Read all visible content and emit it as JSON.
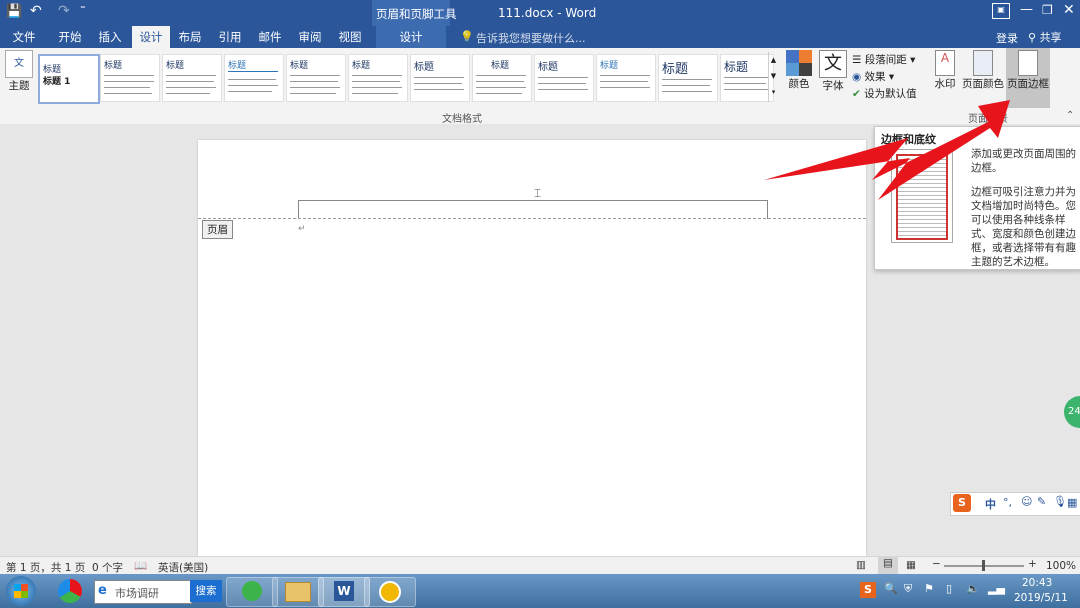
{
  "titlebar": {
    "context_group": "页眉和页脚工具",
    "document_title": "111.docx - Word",
    "quick_access": {
      "save": "💾",
      "undo": "↶",
      "redo": "↷"
    }
  },
  "tabs": [
    "文件",
    "开始",
    "插入",
    "设计",
    "布局",
    "引用",
    "邮件",
    "审阅",
    "视图"
  ],
  "context_tab": "设计",
  "tellme": "告诉我您想要做什么...",
  "signin": "登录",
  "share": "共享",
  "ribbon": {
    "theme_label": "主题",
    "style_titles": [
      "标题",
      "标题",
      "标题",
      "标题",
      "标题",
      "标题",
      "标题",
      "标题",
      "标题",
      "标题",
      "标题",
      "标题"
    ],
    "first_thumb_title": "标题 1",
    "gallery_group_label": "文档格式",
    "colors_label": "颜色",
    "fonts_label": "字体",
    "para_spacing_label": "段落间距",
    "effects_label": "效果",
    "set_default_label": "设为默认值",
    "watermark_label": "水印",
    "page_color_label": "页面颜色",
    "page_border_label": "页面边框",
    "page_bg_group_label": "页面背景"
  },
  "document": {
    "header_tag": "页眉"
  },
  "tooltip": {
    "title": "边框和底纹",
    "line1": "添加或更改页面周围的边框。",
    "line2": "边框可吸引注意力并为文档增加时尚特色。您可以使用各种线条样式、宽度和颜色创建边框，或者选择带有有趣主题的艺术边框。"
  },
  "statusbar": {
    "page": "第 1 页，共 1 页",
    "words": "0 个字",
    "language": "英语(美国)",
    "zoom": "100%"
  },
  "taskbar": {
    "search_text": "市场调研",
    "search_button": "搜索",
    "time": "20:43",
    "date": "2019/5/11"
  },
  "ime_label": "中",
  "floating_badge": "24",
  "colors": {
    "word_blue": "#2b579a",
    "arrow_red": "#e8141c"
  }
}
